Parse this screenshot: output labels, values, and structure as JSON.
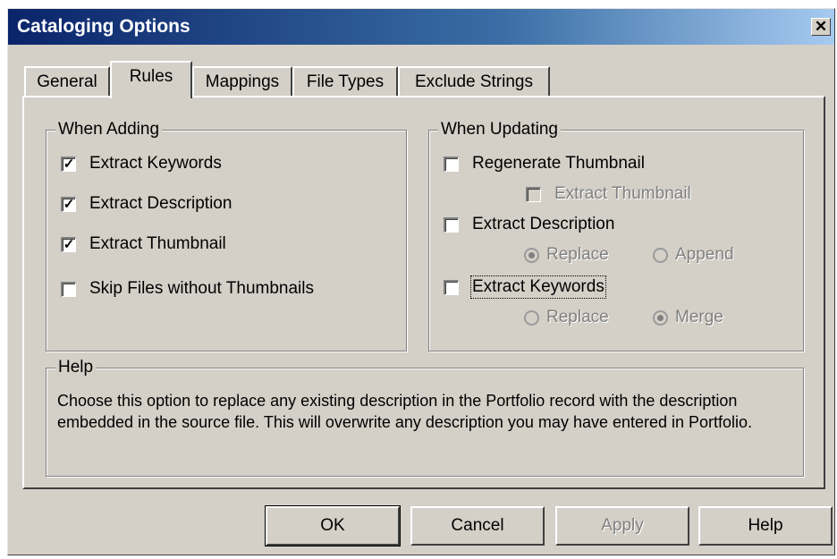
{
  "window": {
    "title": "Cataloging Options",
    "close_glyph": "✕"
  },
  "tabs": [
    {
      "label": "General",
      "active": false
    },
    {
      "label": "Rules",
      "active": true
    },
    {
      "label": "Mappings",
      "active": false
    },
    {
      "label": "File Types",
      "active": false
    },
    {
      "label": "Exclude Strings",
      "active": false
    }
  ],
  "when_adding": {
    "title": "When Adding",
    "items": [
      {
        "label": "Extract Keywords",
        "checked": true
      },
      {
        "label": "Extract Description",
        "checked": true
      },
      {
        "label": "Extract Thumbnail",
        "checked": true
      },
      {
        "label": "Skip Files without Thumbnails",
        "checked": false
      }
    ]
  },
  "when_updating": {
    "title": "When Updating",
    "regenerate_thumbnail": {
      "label": "Regenerate Thumbnail",
      "checked": false
    },
    "extract_thumbnail": {
      "label": "Extract Thumbnail",
      "checked": false,
      "enabled": false
    },
    "extract_description": {
      "label": "Extract Description",
      "checked": false
    },
    "description_options": [
      {
        "label": "Replace",
        "selected": true,
        "enabled": false
      },
      {
        "label": "Append",
        "selected": false,
        "enabled": false
      }
    ],
    "extract_keywords": {
      "label": "Extract Keywords",
      "checked": false,
      "focused": true
    },
    "keywords_options": [
      {
        "label": "Replace",
        "selected": false,
        "enabled": false
      },
      {
        "label": "Merge",
        "selected": true,
        "enabled": false
      }
    ]
  },
  "help": {
    "title": "Help",
    "text": "Choose this option to replace any existing description in the Portfolio record with the description embedded in the source file. This will overwrite any description you may have entered in Portfolio."
  },
  "buttons": {
    "ok": "OK",
    "cancel": "Cancel",
    "apply": "Apply",
    "help": "Help"
  },
  "check_glyph": "✓"
}
